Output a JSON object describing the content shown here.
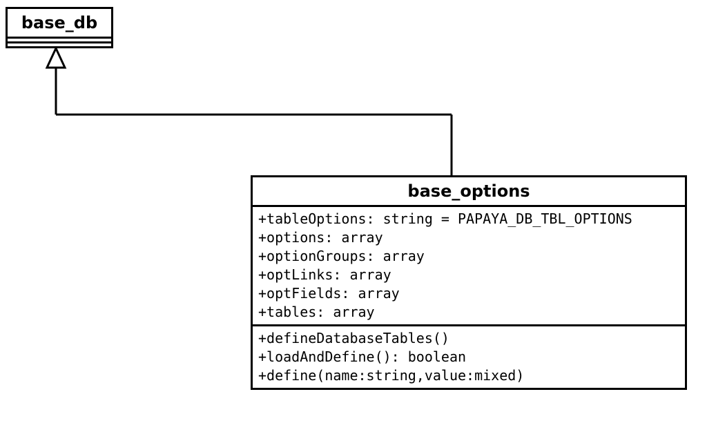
{
  "classes": {
    "base_db": {
      "name": "base_db"
    },
    "base_options": {
      "name": "base_options",
      "attributes": [
        "+tableOptions: string = PAPAYA_DB_TBL_OPTIONS",
        "+options: array",
        "+optionGroups: array",
        "+optLinks: array",
        "+optFields: array",
        "+tables: array"
      ],
      "methods": [
        "+defineDatabaseTables()",
        "+loadAndDefine(): boolean",
        "+define(name:string,value:mixed)"
      ]
    }
  }
}
